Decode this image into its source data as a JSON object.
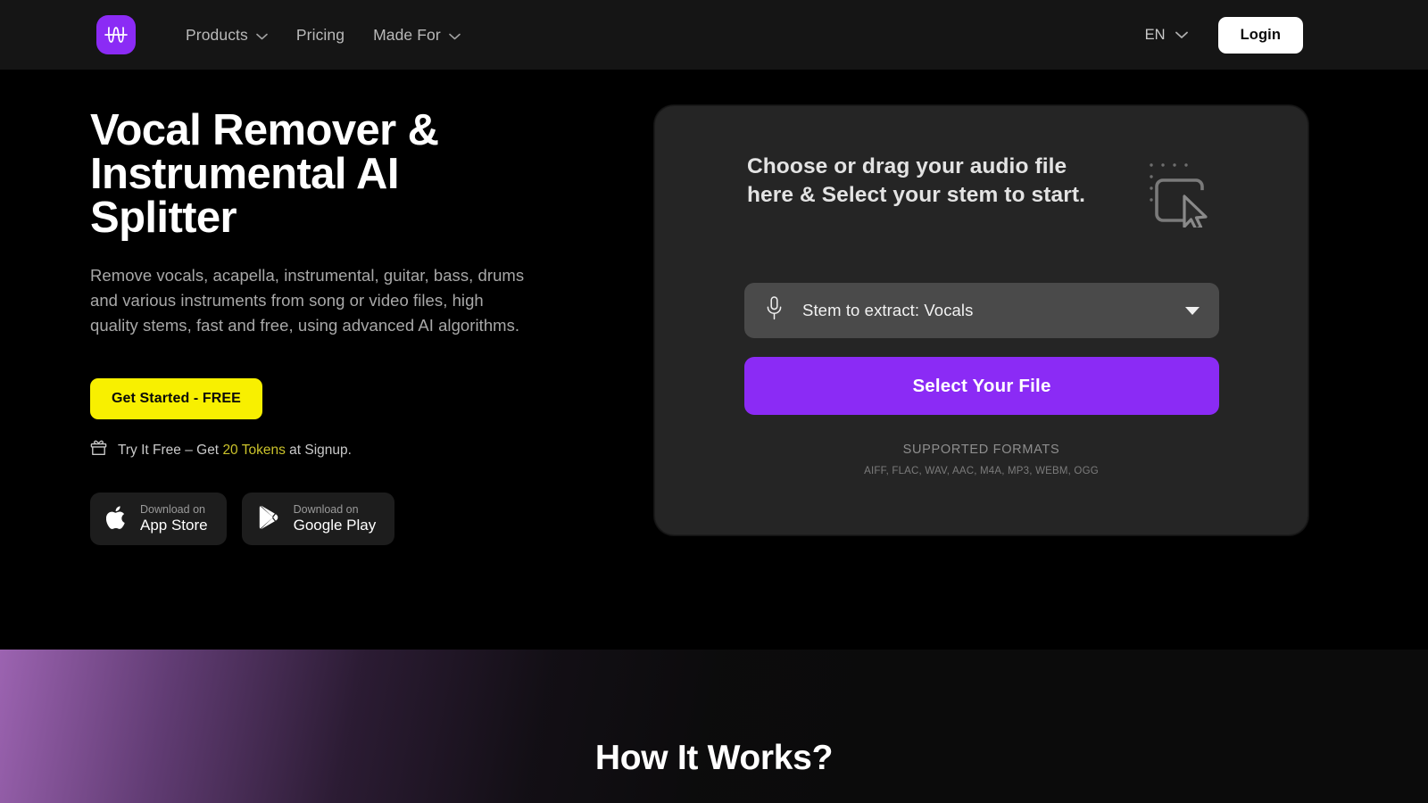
{
  "header": {
    "logo_icon": "audio-waveform-logo",
    "nav": [
      {
        "label": "Products",
        "has_dropdown": true,
        "icon": "chevron-down-icon"
      },
      {
        "label": "Pricing",
        "has_dropdown": false,
        "icon": ""
      },
      {
        "label": "Made For",
        "has_dropdown": true,
        "icon": "chevron-down-icon"
      }
    ],
    "language": {
      "label": "EN",
      "icon": "chevron-down-icon"
    },
    "login_label": "Login"
  },
  "hero": {
    "title_line1": "Vocal Remover &",
    "title_line2": "Instrumental AI",
    "title_line3": "Splitter",
    "description": "Remove vocals, acapella, instrumental, guitar, bass, drums and various instruments from song or video files, high quality stems, fast and free, using advanced AI algorithms.",
    "cta_label": "Get Started - FREE",
    "token_icon": "gift-box-icon",
    "token_text_before": "Try It Free – Get ",
    "token_amount": "20 Tokens",
    "token_text_after": " at Signup.",
    "stores": [
      {
        "icon": "apple-icon",
        "sub": "Download on",
        "main": "App Store"
      },
      {
        "icon": "google-play-icon",
        "sub": "Download on",
        "main": "Google Play"
      }
    ]
  },
  "upload_card": {
    "headline_line1": "Choose or drag your audio file",
    "headline_line2": "here & Select your stem to start.",
    "dragdrop_icon": "drag-and-drop-cursor-icon",
    "stem_select": {
      "icon": "microphone-icon",
      "value": "Stem to extract: Vocals",
      "caret_icon": "caret-down-icon"
    },
    "select_file_label": "Select Your File",
    "formats_title": "SUPPORTED FORMATS",
    "formats_list": "AIFF, FLAC, WAV, AAC, M4A, MP3, WEBM, OGG"
  },
  "how_section": {
    "heading": "How It Works?"
  },
  "colors": {
    "brand_purple": "#8B2BF5",
    "accent_yellow": "#F8F000",
    "token_yellow": "#CBC32B",
    "page_bg": "#000000",
    "header_bg": "#151515",
    "card_bg": "#252525",
    "select_bg": "#4A4A4A"
  }
}
